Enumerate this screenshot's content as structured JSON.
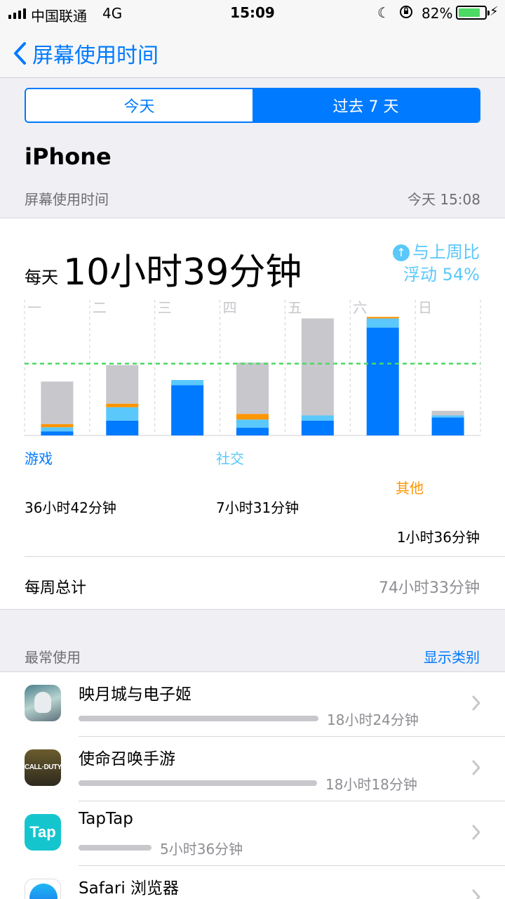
{
  "status_bar": {
    "carrier": "中国联通",
    "network": "4G",
    "time": "15:09",
    "battery_pct": "82%",
    "battery_level": 0.82,
    "icons": [
      "signal-icon",
      "moon-icon",
      "orientation-lock-icon",
      "battery-icon",
      "charging-icon"
    ]
  },
  "nav": {
    "back_label": "屏幕使用时间"
  },
  "segment": {
    "today": "今天",
    "week": "过去 7 天",
    "selected": "week"
  },
  "device": "iPhone",
  "section": {
    "label": "屏幕使用时间",
    "date": "今天 15:08"
  },
  "summary": {
    "prefix": "每天",
    "average": "10小时39分钟",
    "compare_line1": "与上周比",
    "compare_line2": "浮动 54%"
  },
  "colors": {
    "games": "#007aff",
    "social": "#5ac8fa",
    "other": "#ff9500",
    "rest": "#c7c7cc",
    "average_line": "#4cd964"
  },
  "chart_data": {
    "type": "bar",
    "stacked": true,
    "categories": [
      "一",
      "二",
      "三",
      "四",
      "五",
      "六",
      "日"
    ],
    "unit": "hours",
    "series": [
      {
        "name": "游戏",
        "values": [
          0.8,
          2.9,
          9.8,
          1.5,
          2.9,
          21.0,
          3.5
        ]
      },
      {
        "name": "社交",
        "values": [
          0.8,
          2.6,
          1.0,
          1.6,
          1.0,
          1.8,
          0.4
        ]
      },
      {
        "name": "其他",
        "values": [
          0.6,
          0.7,
          0.0,
          1.1,
          0.0,
          0.3,
          0.0
        ]
      },
      {
        "values": [
          8.3,
          7.5,
          0.0,
          10.0,
          18.9,
          0.0,
          0.9
        ]
      }
    ],
    "average": 14.0,
    "ymax": 26,
    "grid": true
  },
  "legend": [
    {
      "label": "游戏",
      "value": "36小时42分钟"
    },
    {
      "label": "社交",
      "value": "7小时31分钟"
    },
    {
      "label": "其他",
      "value": "1小时36分钟"
    }
  ],
  "weekly": {
    "label": "每周总计",
    "value": "74小时33分钟"
  },
  "most_used": {
    "title": "最常使用",
    "show_categories": "显示类别",
    "apps": [
      {
        "name": "映月城与电子姬",
        "time": "18小时24分钟",
        "usage": 1.0,
        "icon": "anime-game-icon"
      },
      {
        "name": "使命召唤手游",
        "time": "18小时18分钟",
        "usage": 0.995,
        "icon": "call-of-duty-icon",
        "icon_text": "CALL·DUTY"
      },
      {
        "name": "TapTap",
        "time": "5小时36分钟",
        "usage": 0.305,
        "icon": "taptap-icon",
        "icon_text": "Tap"
      },
      {
        "name": "Safari 浏览器",
        "time": "",
        "usage": 0.0,
        "icon": "safari-icon"
      }
    ]
  }
}
